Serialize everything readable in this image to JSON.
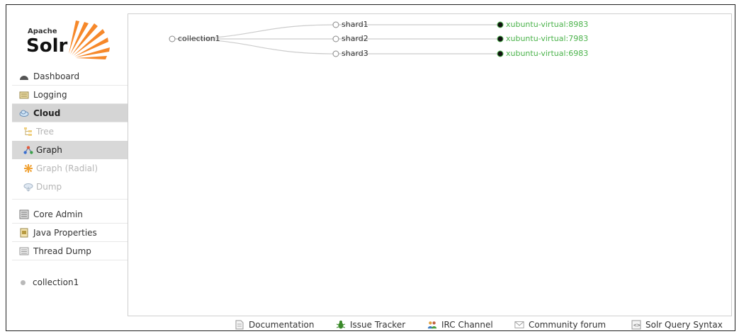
{
  "logo": {
    "apache": "Apache",
    "solr": "Solr"
  },
  "sidebar": {
    "items": [
      {
        "label": "Dashboard",
        "icon": "dashboard-icon"
      },
      {
        "label": "Logging",
        "icon": "logging-icon"
      },
      {
        "label": "Cloud",
        "icon": "cloud-icon",
        "active": true
      }
    ],
    "cloud_sub": [
      {
        "label": "Tree",
        "icon": "tree-icon",
        "state": "disabled"
      },
      {
        "label": "Graph",
        "icon": "graph-icon",
        "state": "active"
      },
      {
        "label": "Graph (Radial)",
        "icon": "radial-icon",
        "state": "disabled"
      },
      {
        "label": "Dump",
        "icon": "dump-icon",
        "state": "disabled"
      }
    ],
    "items2": [
      {
        "label": "Core Admin",
        "icon": "core-admin-icon"
      },
      {
        "label": "Java Properties",
        "icon": "java-icon"
      },
      {
        "label": "Thread Dump",
        "icon": "thread-icon"
      }
    ],
    "core": {
      "label": "collection1"
    }
  },
  "graph": {
    "collection": "collection1",
    "shards": [
      "shard1",
      "shard2",
      "shard3"
    ],
    "hosts": [
      "xubuntu-virtual:8983",
      "xubuntu-virtual:7983",
      "xubuntu-virtual:6983"
    ],
    "colors": {
      "host": "#4bb34b",
      "edge": "#cccccc"
    }
  },
  "footer": {
    "documentation": "Documentation",
    "issue_tracker": "Issue Tracker",
    "irc_channel": "IRC Channel",
    "community_forum": "Community forum",
    "query_syntax": "Solr Query Syntax"
  }
}
